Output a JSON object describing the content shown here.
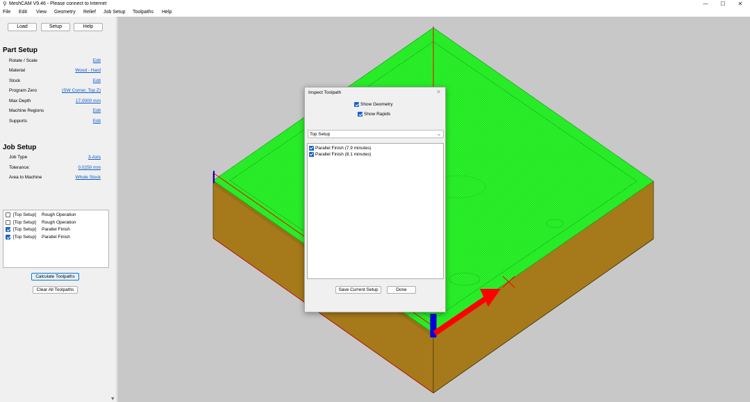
{
  "window": {
    "title": "MeshCAM V9.46 - Please connect to Internet",
    "icon": "meshcam-app-icon",
    "controls": {
      "minimize": "—",
      "maximize": "☐",
      "close": "✕"
    }
  },
  "menu": [
    "File",
    "Edit",
    "View",
    "Geometry",
    "Relief",
    "Job Setup",
    "Toolpaths",
    "Help"
  ],
  "toolbar": {
    "load": "Load",
    "setup": "Setup",
    "help": "Help"
  },
  "part_setup": {
    "title": "Part Setup",
    "rows": [
      {
        "label": "Rotate / Scale",
        "value": "Edit"
      },
      {
        "label": "Material",
        "value": "Wood - Hard"
      },
      {
        "label": "Stock",
        "value": "Edit"
      },
      {
        "label": "Program Zero",
        "value": "(SW Corner, Top Z)"
      },
      {
        "label": "Max Depth",
        "value": "17.0000 mm"
      },
      {
        "label": "Machine Regions",
        "value": "Edit"
      },
      {
        "label": "Supports",
        "value": "Edit"
      }
    ]
  },
  "job_setup": {
    "title": "Job Setup",
    "rows": [
      {
        "label": "Job Type",
        "value": "3-Axis"
      },
      {
        "label": "Tolerance:",
        "value": "0.0250 mm"
      },
      {
        "label": "Area to Machine",
        "value": "Whole Stock"
      }
    ]
  },
  "operations": [
    {
      "setup": "[Top Setup]",
      "name": "Rough Operation",
      "checked": false
    },
    {
      "setup": "[Top Setup]",
      "name": "Rough Operation",
      "checked": false
    },
    {
      "setup": "[Top Setup]",
      "name": "Parallel Finish",
      "checked": true
    },
    {
      "setup": "[Top Setup]",
      "name": "Parallel Finish",
      "checked": true
    }
  ],
  "actions": {
    "calculate": "Calculate Toolpaths",
    "clear": "Clear All Toolpaths"
  },
  "dialog": {
    "title": "Inspect Toolpath",
    "close": "✕",
    "show_geometry": "Show Geometry",
    "show_rapids": "Show Rapids",
    "setup_select": "Top Setup",
    "toolpaths": [
      "Parallel Finish (7.9 minutes)",
      "Parallel Finish (8.1 minutes)"
    ],
    "save_button": "Save Current Setup",
    "done_button": "Done"
  },
  "colors": {
    "viewport_bg": "#c8c8c8",
    "stock_side": "#a67a1a",
    "toolpath_green": "#33ff33",
    "axis_red": "#ff0000",
    "axis_blue": "#0000dd",
    "link": "#0a5ac8",
    "check_blue": "#1a63c5"
  }
}
